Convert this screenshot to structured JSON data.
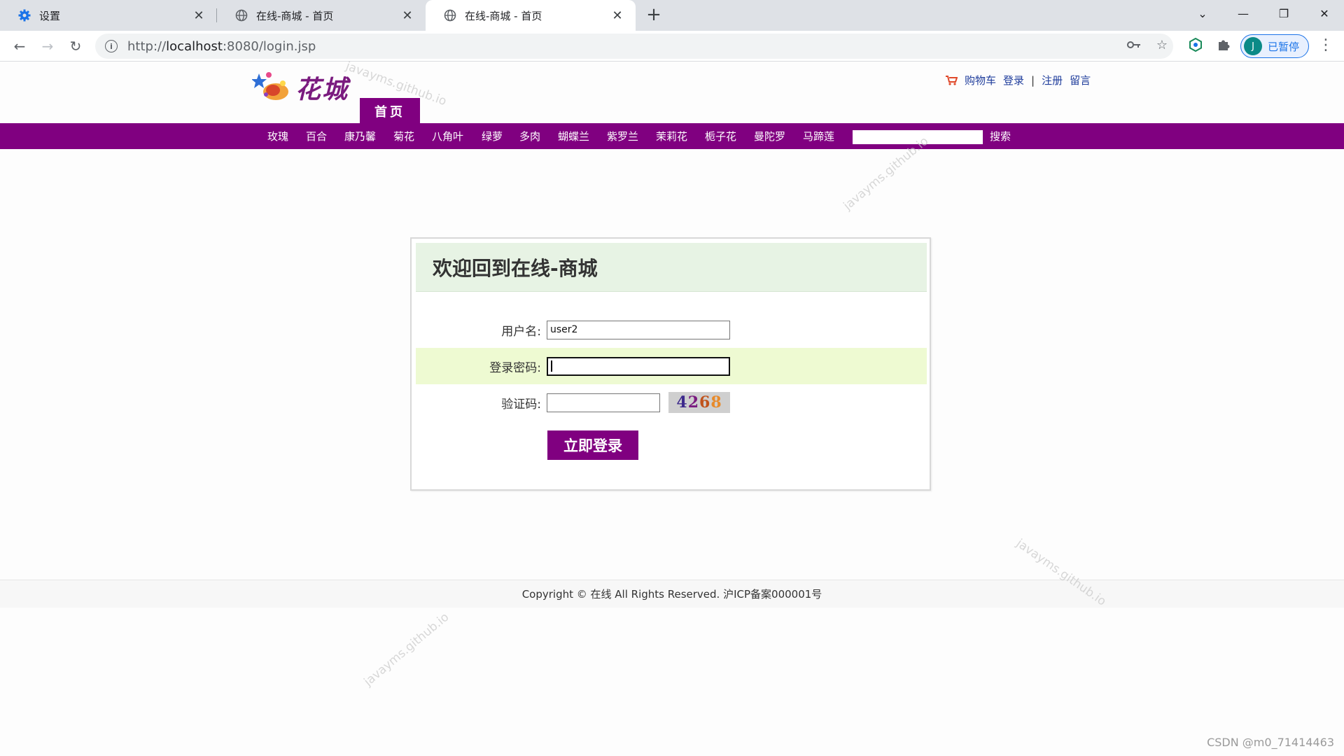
{
  "browser": {
    "tabs": [
      {
        "title": "设置",
        "icon": "gear-icon"
      },
      {
        "title": "在线-商城 - 首页",
        "icon": "globe-icon"
      },
      {
        "title": "在线-商城 - 首页",
        "icon": "globe-icon",
        "active": true
      }
    ],
    "url_prefix": "http://",
    "url_host": "localhost",
    "url_rest": ":8080/login.jsp",
    "profile_initial": "J",
    "profile_status": "已暂停"
  },
  "header": {
    "logo_text": "花城",
    "home_tab": "首页",
    "cart": "购物车",
    "login": "登录",
    "separator": "|",
    "register": "注册",
    "message": "留言"
  },
  "nav": {
    "categories": [
      "玫瑰",
      "百合",
      "康乃馨",
      "菊花",
      "八角叶",
      "绿萝",
      "多肉",
      "蝴蝶兰",
      "紫罗兰",
      "茉莉花",
      "栀子花",
      "曼陀罗",
      "马蹄莲"
    ],
    "search_label": "搜索",
    "search_value": ""
  },
  "login": {
    "title": "欢迎回到在线-商城",
    "username_label": "用户名:",
    "username_value": "user2",
    "password_label": "登录密码:",
    "captcha_label": "验证码:",
    "captcha_value": "",
    "captcha_digits": [
      "4",
      "2",
      "6",
      "8"
    ],
    "submit": "立即登录"
  },
  "footer": {
    "text": "Copyright © 在线 All Rights Reserved. 沪ICP备案000001号"
  },
  "overlay": {
    "watermark": "javayms.github.io",
    "credit": "CSDN @m0_71414463"
  },
  "colors": {
    "brand": "#800080",
    "header_bg": "#e7f3e4",
    "highlight_row": "#eefad2"
  }
}
